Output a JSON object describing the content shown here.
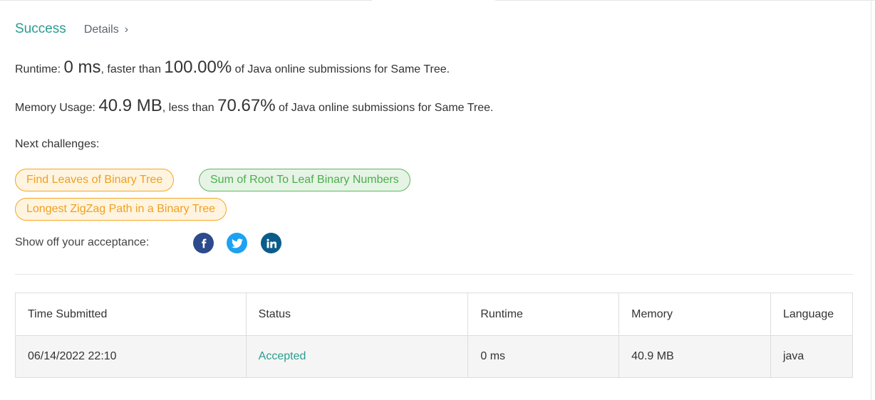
{
  "result": {
    "status": "Success",
    "details_label": "Details",
    "details_chevron": "›"
  },
  "runtime": {
    "label": "Runtime: ",
    "value": "0 ms",
    "comparison": ", faster than ",
    "percent": "100.00%",
    "suffix": " of Java online submissions for Same Tree."
  },
  "memory": {
    "label": "Memory Usage: ",
    "value": "40.9 MB",
    "comparison": ", less than ",
    "percent": "70.67%",
    "suffix": " of Java online submissions for Same Tree."
  },
  "next_challenges": {
    "label": "Next challenges:",
    "items": [
      {
        "title": "Find Leaves of Binary Tree",
        "difficulty_color": "orange"
      },
      {
        "title": "Sum of Root To Leaf Binary Numbers",
        "difficulty_color": "green"
      },
      {
        "title": "Longest ZigZag Path in a Binary Tree",
        "difficulty_color": "orange"
      }
    ]
  },
  "share": {
    "label": "Show off your acceptance:",
    "icons": [
      "facebook-icon",
      "twitter-icon",
      "linkedin-icon"
    ]
  },
  "submissions": {
    "headers": [
      "Time Submitted",
      "Status",
      "Runtime",
      "Memory",
      "Language"
    ],
    "rows": [
      {
        "time": "06/14/2022 22:10",
        "status": "Accepted",
        "runtime": "0 ms",
        "memory": "40.9 MB",
        "language": "java"
      }
    ]
  },
  "colors": {
    "success": "#2a9d8f",
    "orange_pill_border": "#f5a623",
    "green_pill_border": "#5cb85c",
    "facebook": "#2c4a8c",
    "twitter": "#1da1f2",
    "linkedin": "#0b5c8a"
  }
}
